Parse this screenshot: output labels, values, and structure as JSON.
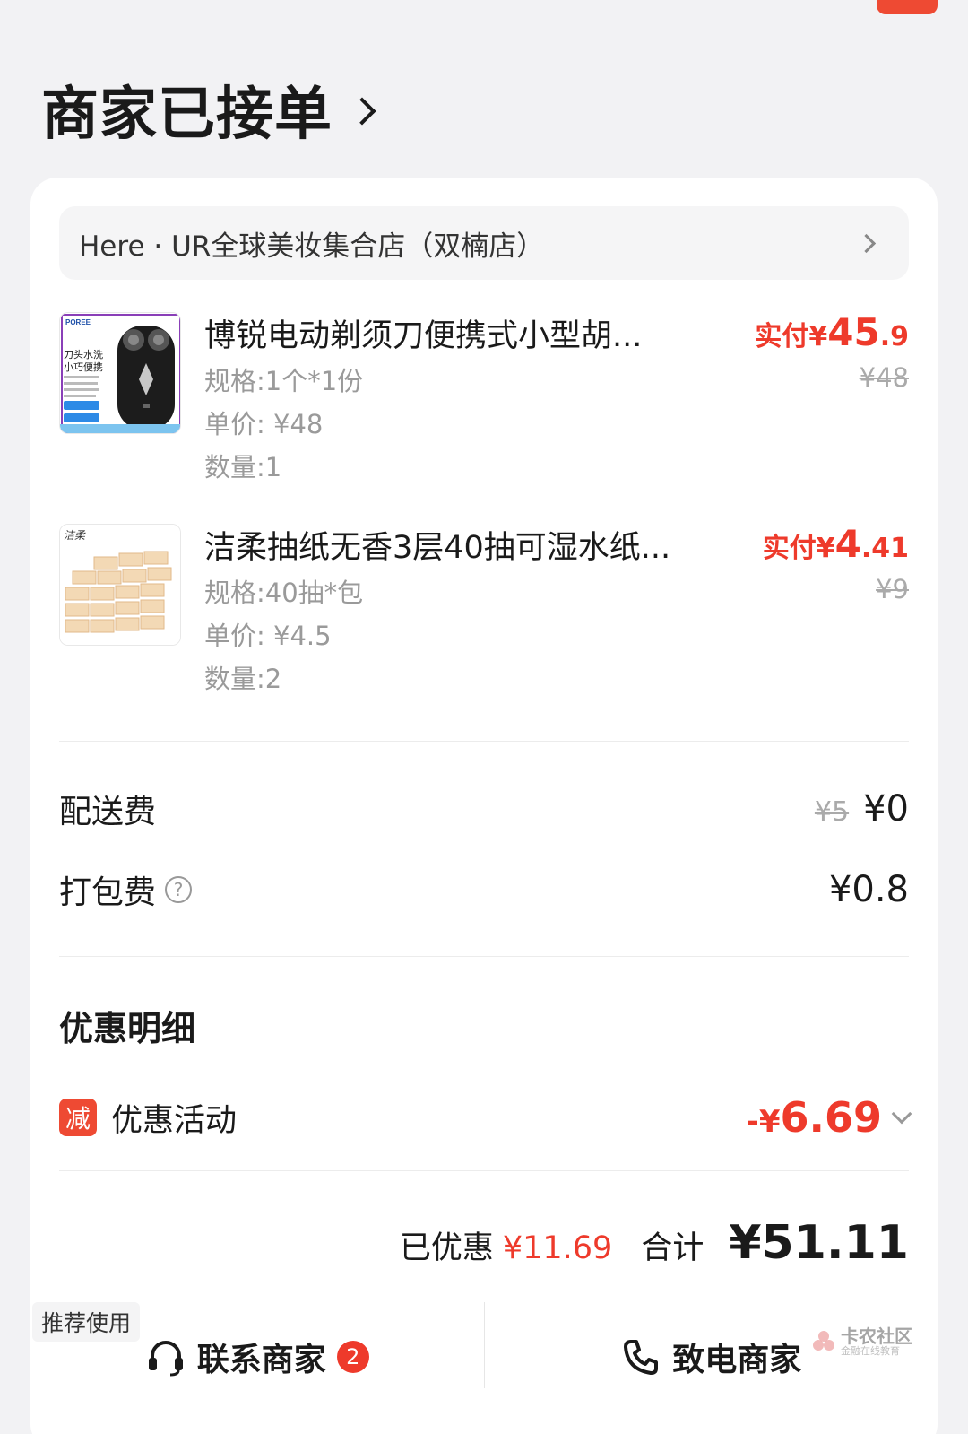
{
  "header": {
    "status_title": "商家已接单"
  },
  "store": {
    "name": "Here · UR全球美妆集合店（双楠店）"
  },
  "products": [
    {
      "name": "博锐电动剃须刀便携式小型胡...",
      "spec": "规格:1个*1份",
      "unit_price": "单价: ¥48",
      "quantity": "数量:1",
      "paid_label": "实付¥",
      "paid_int": "45",
      "paid_dec": ".9",
      "original_price": "¥48",
      "thumb_brand": "POREE",
      "thumb_line1": "刀头水洗",
      "thumb_line2": "小巧便携"
    },
    {
      "name": "洁柔抽纸无香3层40抽可湿水纸...",
      "spec": "规格:40抽*包",
      "unit_price": "单价: ¥4.5",
      "quantity": "数量:2",
      "paid_label": "实付¥",
      "paid_int": "4",
      "paid_dec": ".41",
      "original_price": "¥9",
      "thumb_brand": "洁柔"
    }
  ],
  "fees": {
    "delivery_label": "配送费",
    "delivery_original": "¥5",
    "delivery_value": "¥0",
    "packing_label": "打包费",
    "packing_value": "¥0.8"
  },
  "discounts": {
    "section_title": "优惠明细",
    "badge": "减",
    "activity_label": "优惠活动",
    "minus_sign": "-¥",
    "amount": "6.69"
  },
  "totals": {
    "saved_label": "已优惠",
    "saved_value": "¥11.69",
    "sum_label": "合计",
    "sum_value": "¥51.11"
  },
  "actions": {
    "recommend_tag": "推荐使用",
    "contact_label": "联系商家",
    "contact_badge": "2",
    "call_label": "致电商家"
  },
  "watermark": {
    "main": "卡农社区",
    "sub": "金融在线教育"
  },
  "colors": {
    "accent": "#ee3a2b",
    "background": "#f2f2f4",
    "card": "#ffffff"
  }
}
